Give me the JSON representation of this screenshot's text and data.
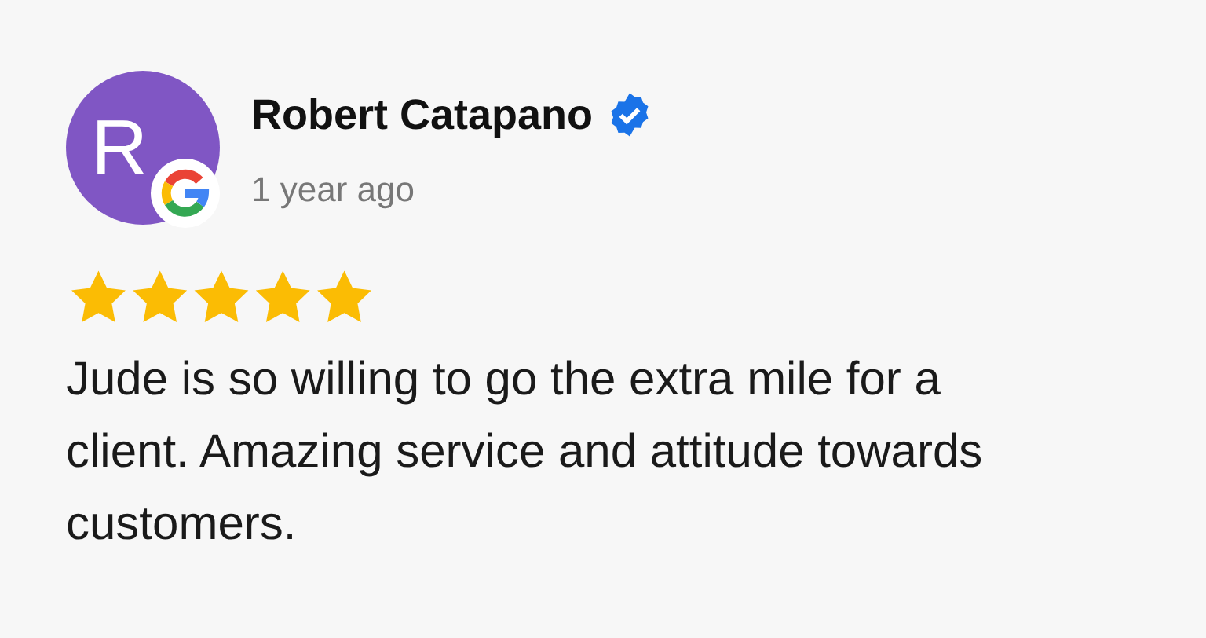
{
  "review": {
    "avatar_initial": "R",
    "name": "Robert Catapano",
    "verified": true,
    "time": "1 year ago",
    "stars": 5,
    "text": "Jude is so willing to go the extra mile for a client. Amazing service and attitude towards customers."
  }
}
